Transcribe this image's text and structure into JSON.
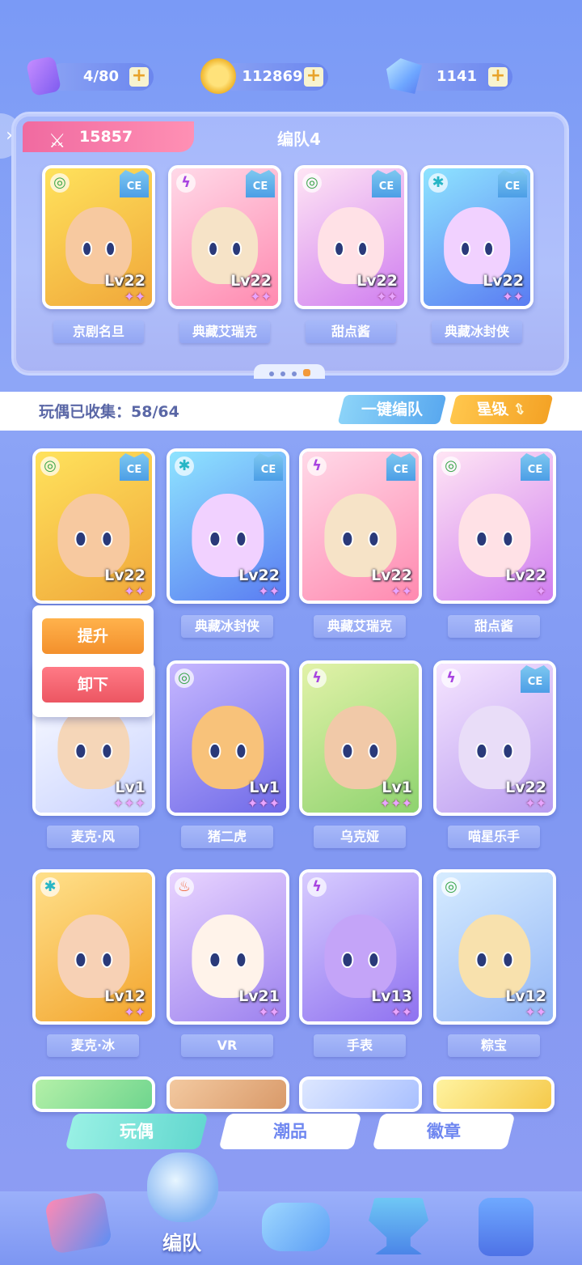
{
  "currencies": [
    {
      "icon": "stamina-card-icon",
      "value": "4/80"
    },
    {
      "icon": "gold-coin-icon",
      "value": "112869"
    },
    {
      "icon": "crystal-icon",
      "value": "1141"
    }
  ],
  "plus_symbol": "+",
  "team": {
    "power": "15857",
    "title": "编队4",
    "members": [
      {
        "name": "京剧名旦",
        "level": "Lv22",
        "stars": "✦✦",
        "element": "◎",
        "badge": "CE"
      },
      {
        "name": "典藏艾瑞克",
        "level": "Lv22",
        "stars": "✦✦",
        "element": "ϟ",
        "badge": "CE"
      },
      {
        "name": "甜点酱",
        "level": "Lv22",
        "stars": "✦✦",
        "element": "◎",
        "badge": "CE"
      },
      {
        "name": "典藏冰封侠",
        "level": "Lv22",
        "stars": "✦✦",
        "element": "✱",
        "badge": "CE"
      }
    ]
  },
  "collection": {
    "label": "玩偶已收集：58/64",
    "auto_team_button": "一键编队",
    "sort_button": "星级",
    "sort_icon": "⇕"
  },
  "popup": {
    "upgrade": "提升",
    "unequip": "卸下"
  },
  "dolls": [
    {
      "name": "",
      "level": "Lv22",
      "stars": "✦✦",
      "element": "◎",
      "badge": "CE"
    },
    {
      "name": "典藏冰封侠",
      "level": "Lv22",
      "stars": "✦✦",
      "element": "✱",
      "badge": "CE"
    },
    {
      "name": "典藏艾瑞克",
      "level": "Lv22",
      "stars": "✦✦",
      "element": "ϟ",
      "badge": "CE"
    },
    {
      "name": "甜点酱",
      "level": "Lv22",
      "stars": "✦",
      "element": "◎",
      "badge": "CE"
    },
    {
      "name": "麦克·风",
      "level": "Lv1",
      "stars": "✦✦✦",
      "element": "◎",
      "badge": ""
    },
    {
      "name": "猪二虎",
      "level": "Lv1",
      "stars": "✦✦✦",
      "element": "◎",
      "badge": ""
    },
    {
      "name": "乌克娅",
      "level": "Lv1",
      "stars": "✦✦✦",
      "element": "ϟ",
      "badge": ""
    },
    {
      "name": "喵星乐手",
      "level": "Lv22",
      "stars": "✦✦",
      "element": "ϟ",
      "badge": "CE"
    },
    {
      "name": "麦克·冰",
      "level": "Lv12",
      "stars": "✦✦",
      "element": "✱",
      "badge": ""
    },
    {
      "name": "VR",
      "level": "Lv21",
      "stars": "✦✦",
      "element": "♨",
      "badge": ""
    },
    {
      "name": "手表",
      "level": "Lv13",
      "stars": "✦✦",
      "element": "ϟ",
      "badge": ""
    },
    {
      "name": "粽宝",
      "level": "Lv12",
      "stars": "✦✦",
      "element": "◎",
      "badge": ""
    }
  ],
  "tabs": [
    "玩偶",
    "潮品",
    "徽章"
  ],
  "nav": {
    "active_label": "编队",
    "items": [
      "upgrade-arrow-icon",
      "whistle-icon",
      "gamepad-icon",
      "trophy-icon",
      "mystery-machine-icon"
    ]
  },
  "colors": {
    "accent_pink": "#f06aa0",
    "accent_orange": "#f4a326",
    "accent_blue": "#5aa9ef",
    "tab_active": "#63d8cf",
    "bg_blue": "#7f97f2"
  }
}
